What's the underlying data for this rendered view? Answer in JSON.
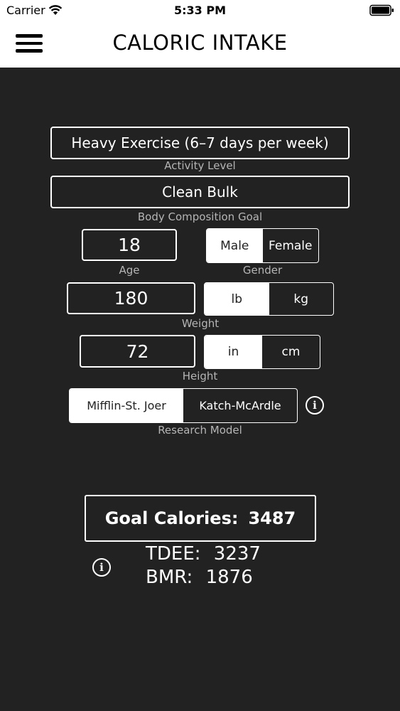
{
  "status_bar": {
    "carrier": "Carrier",
    "time": "5:33 PM"
  },
  "header": {
    "title": "CALORIC INTAKE",
    "menu_icon": "hamburger-menu-icon"
  },
  "activity": {
    "value": "Heavy Exercise (6–7 days per week)",
    "label": "Activity Level"
  },
  "goal": {
    "value": "Clean Bulk",
    "label": "Body Composition Goal"
  },
  "age": {
    "value": "18",
    "label": "Age"
  },
  "gender": {
    "label": "Gender",
    "options": [
      "Male",
      "Female"
    ],
    "selected": "Male"
  },
  "weight": {
    "value": "180",
    "label": "Weight",
    "units": [
      "lb",
      "kg"
    ],
    "selected": "lb"
  },
  "height": {
    "value": "72",
    "label": "Height",
    "units": [
      "in",
      "cm"
    ],
    "selected": "in"
  },
  "model": {
    "label": "Research Model",
    "options": [
      "Mifflin-St. Joer",
      "Katch-McArdle"
    ],
    "selected": "Mifflin-St. Joer"
  },
  "results": {
    "goal_label": "Goal Calories:",
    "goal_value": "3487",
    "tdee_label": "TDEE:",
    "tdee_value": "3237",
    "bmr_label": "BMR:",
    "bmr_value": "1876"
  },
  "info_glyph": "i"
}
